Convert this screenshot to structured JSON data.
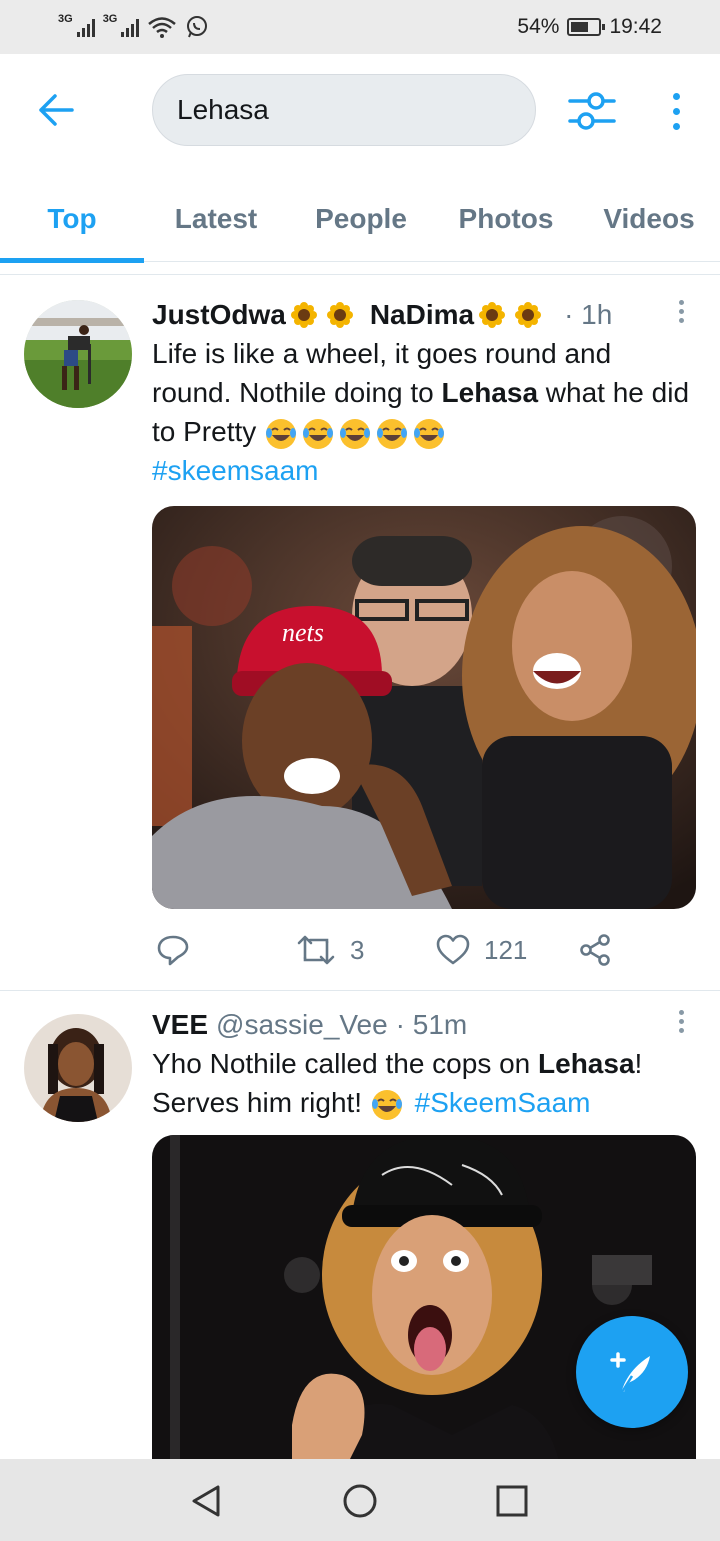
{
  "status_bar": {
    "network_1": "3G",
    "network_2": "3G",
    "battery": "54%",
    "time": "19:42"
  },
  "search": {
    "query": "Lehasa"
  },
  "tabs": [
    {
      "label": "Top",
      "active": true
    },
    {
      "label": "Latest",
      "active": false
    },
    {
      "label": "People",
      "active": false
    },
    {
      "label": "Photos",
      "active": false
    },
    {
      "label": "Videos",
      "active": false
    }
  ],
  "tweets": [
    {
      "name_1": "JustOdwa",
      "name_2": "NaDima",
      "time": "· 1h",
      "text_1": "Life is like a wheel, it goes round and round. Nothile doing to ",
      "highlight": "Lehasa",
      "text_2": " what he did to Pretty ",
      "hashtag": "#skeemsaam",
      "emoji_count": 5,
      "replies": "",
      "retweets": "3",
      "likes": "121"
    },
    {
      "name": "VEE",
      "handle": "@sassie_Vee",
      "time": "· 51m",
      "text_1": "Yho Nothile called the cops on ",
      "highlight": "Lehasa",
      "text_2": "! Serves him right! ",
      "hashtag": "#SkeemSaam"
    }
  ],
  "colors": {
    "accent": "#1da1f2",
    "secondary_text": "#657786",
    "primary_text": "#14171a"
  },
  "icons": {
    "back": "arrow-left-icon",
    "filter": "sliders-icon",
    "more": "vertical-dots-icon",
    "reply": "reply-icon",
    "retweet": "retweet-icon",
    "like": "heart-icon",
    "share": "share-icon",
    "compose": "compose-feather-icon"
  }
}
